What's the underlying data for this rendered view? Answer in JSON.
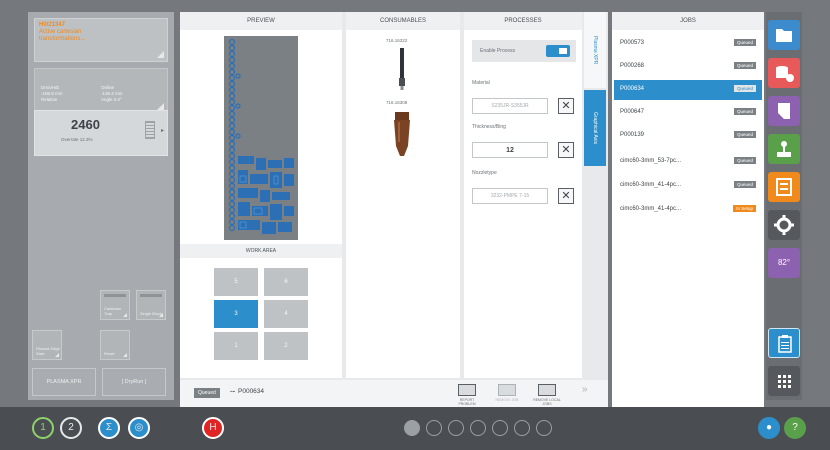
{
  "alarm": {
    "line1": "H0/21347",
    "line2": "Active cartesian",
    "line3": "transformations..."
  },
  "coords": {
    "col1": [
      "Dmn/Hdt",
      "-106.9 mm",
      "Relative"
    ],
    "col2": [
      "Online",
      "-135.4 mm",
      "Angle 0.0°"
    ]
  },
  "counter": {
    "value": "2460",
    "overrate": "Overrate 12.3%"
  },
  "left_buttons": {
    "cartesian": "Cartesian Trap",
    "single": "Single Block",
    "plasma": "Plasma Edge Start",
    "reset": "Reset",
    "plasma_xpr": "PLASMA XPR",
    "dry_run": "[ DryRun ]"
  },
  "preview": {
    "title": "PREVIEW",
    "work_area": "WORK AREA",
    "cells": [
      "5",
      "6",
      "3",
      "4",
      "1",
      "2"
    ]
  },
  "consumables": {
    "title": "CONSUMABLES",
    "code1": "716.16322",
    "code2": "716.16308"
  },
  "processes": {
    "title": "PROCESSES",
    "enable": "Enable Process",
    "material_label": "Material",
    "material_value": "S235JR-S355JR",
    "thickness_label": "Thickness/Bing",
    "thickness_value": "12",
    "nozzle_label": "Nozzletype",
    "nozzle_value": "3232-PMPE 7-15"
  },
  "tabs": {
    "plasma": "Plasma XPR",
    "graphical": "Graphical Axis"
  },
  "jobs": {
    "title": "JOBS",
    "items": [
      {
        "name": "P000573",
        "status": "Queued"
      },
      {
        "name": "P000268",
        "status": "Queued"
      },
      {
        "name": "P000634",
        "status": "Queued"
      },
      {
        "name": "P000647",
        "status": "Queued"
      },
      {
        "name": "P000139",
        "status": "Queued"
      },
      {
        "name": "cimc60-3mm_53-7pc...",
        "status": "Queued"
      },
      {
        "name": "cimc60-3mm_41-4pc...",
        "status": "Queued"
      },
      {
        "name": "cimc60-3mm_41-4pc...",
        "status": "In Setup"
      }
    ]
  },
  "statusbar": {
    "status": "Queued",
    "job": "P000634",
    "actions": [
      "REPORT PROBLEM",
      "REMOVE JOB",
      "REMOVE LOCAL JOBS"
    ]
  },
  "rtb": {
    "temp": "82°"
  },
  "bottom": {
    "n1": "1",
    "n2": "2",
    "sigma": "Σ"
  },
  "colors": {
    "accent": "#2c8fcb",
    "orange": "#f08a1c",
    "red": "#e85a5a",
    "purple": "#8b61b0",
    "green": "#5aa04b"
  }
}
